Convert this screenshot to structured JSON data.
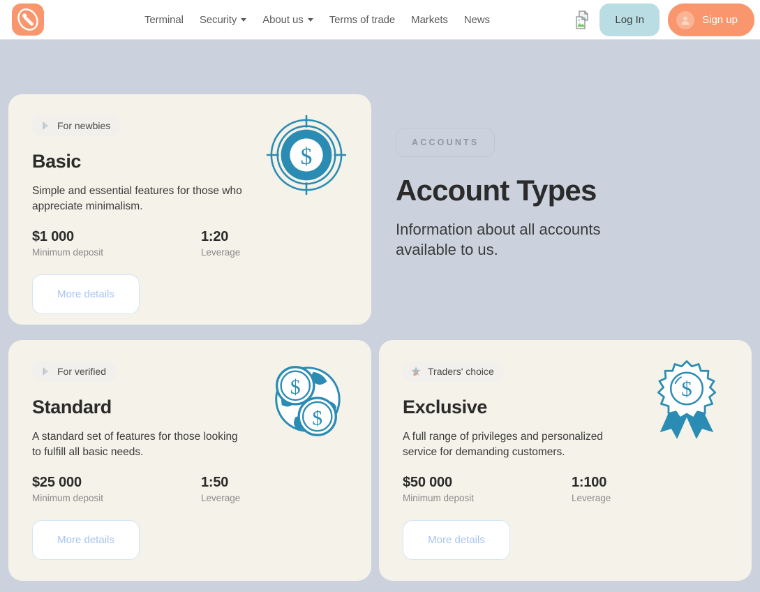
{
  "header": {
    "logo_icon": "brand-logo-icon",
    "nav": [
      {
        "label": "Terminal",
        "has_dropdown": false
      },
      {
        "label": "Security",
        "has_dropdown": true
      },
      {
        "label": "About us",
        "has_dropdown": true
      },
      {
        "label": "Terms of trade",
        "has_dropdown": false
      },
      {
        "label": "Markets",
        "has_dropdown": false
      },
      {
        "label": "News",
        "has_dropdown": false
      }
    ],
    "broken_image_icon": "broken-image-icon",
    "login_label": "Log In",
    "signup_label": "Sign up",
    "avatar_icon": "user-avatar-icon"
  },
  "hero": {
    "tag": "ACCOUNTS",
    "title": "Account Types",
    "subtitle": "Information about all accounts available to us."
  },
  "cards": [
    {
      "badge": "For newbies",
      "badge_icon": "play-triangle-icon",
      "title": "Basic",
      "description": "Simple and essential features for those who appreciate minimalism.",
      "deposit_value": "$1 000",
      "deposit_label": "Minimum deposit",
      "leverage_value": "1:20",
      "leverage_label": "Leverage",
      "button": "More details",
      "art_icon": "target-dollar-coin-icon"
    },
    {
      "badge": "For verified",
      "badge_icon": "play-triangle-icon",
      "title": "Standard",
      "description": "A standard set of features for those looking to fulfill all basic needs.",
      "deposit_value": "$25 000",
      "deposit_label": "Minimum deposit",
      "leverage_value": "1:50",
      "leverage_label": "Leverage",
      "button": "More details",
      "art_icon": "globe-coins-icon"
    },
    {
      "badge": "Traders' choice",
      "badge_icon": "shooting-star-icon",
      "title": "Exclusive",
      "description": "A full range of privileges and personalized service for demanding customers.",
      "deposit_value": "$50 000",
      "deposit_label": "Minimum deposit",
      "leverage_value": "1:100",
      "leverage_label": "Leverage",
      "button": "More details",
      "art_icon": "award-ribbon-dollar-icon"
    }
  ],
  "colors": {
    "page_background": "#ccd2dd",
    "card_background": "#f4f2e9",
    "brand_orange": "#f9966d",
    "login_teal": "#b9dde3",
    "art_blue": "#2b8cb3",
    "link_blue": "#a6c4f0"
  }
}
